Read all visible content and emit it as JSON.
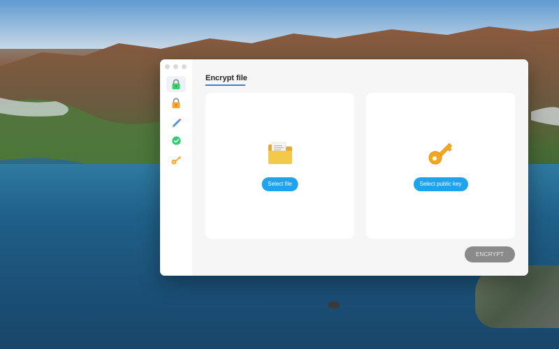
{
  "window": {
    "title": "Encrypt file"
  },
  "sidebar": {
    "items": [
      {
        "icon": "lock-green-icon",
        "active": true
      },
      {
        "icon": "lock-orange-icon",
        "active": false
      },
      {
        "icon": "pen-icon",
        "active": false
      },
      {
        "icon": "check-badge-icon",
        "active": false
      },
      {
        "icon": "key-icon",
        "active": false
      }
    ]
  },
  "main": {
    "select_file_label": "Select file",
    "select_public_key_label": "Select public key",
    "encrypt_label": "ENCRYPT"
  },
  "colors": {
    "accent": "#1fa2ef",
    "tab_underline": "#3f7fd1",
    "encrypt_disabled": "#8a8a8a",
    "folder": "#f3c94a",
    "key": "#f5a623",
    "lock_green": "#3ccf6e"
  }
}
